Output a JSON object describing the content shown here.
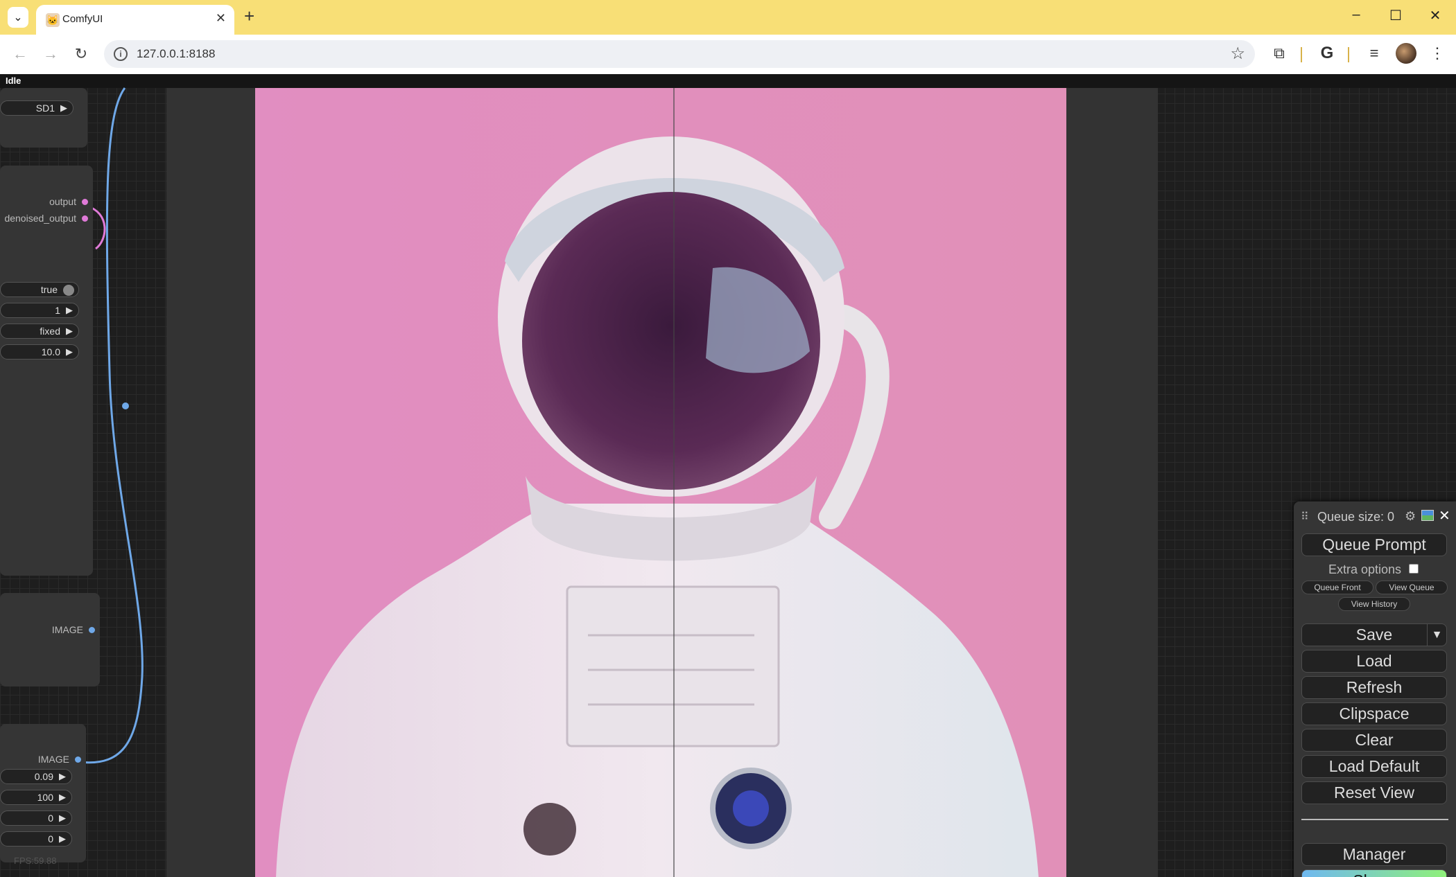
{
  "browser": {
    "tab_title": "ComfyUI",
    "url": "127.0.0.1:8188",
    "new_tab_symbol": "+",
    "tab_close_symbol": "✕"
  },
  "status": "Idle",
  "left_nodes": {
    "top_widget": "SD1",
    "outputs": [
      "output",
      "denoised_output"
    ],
    "widgets_a": [
      "true",
      "1",
      "fixed",
      "10.0"
    ],
    "image_output_1": "IMAGE",
    "image_output_2": "IMAGE",
    "widgets_b": [
      "0.09",
      "100",
      "0",
      "0"
    ],
    "fps": "FPS:59.88"
  },
  "panel": {
    "queue_size_label": "Queue size: 0",
    "queue_prompt": "Queue Prompt",
    "extra_options": "Extra options",
    "queue_front": "Queue Front",
    "view_queue": "View Queue",
    "view_history": "View History",
    "save": "Save",
    "load": "Load",
    "refresh": "Refresh",
    "clipspace": "Clipspace",
    "clear": "Clear",
    "load_default": "Load Default",
    "reset_view": "Reset View",
    "manager": "Manager",
    "share": "Share"
  },
  "colors": {
    "accent_pink": "#e18ec1",
    "link_blue": "#6fa8e8",
    "share_gradient_start": "#6fb8f0",
    "share_gradient_end": "#8ff07a"
  }
}
